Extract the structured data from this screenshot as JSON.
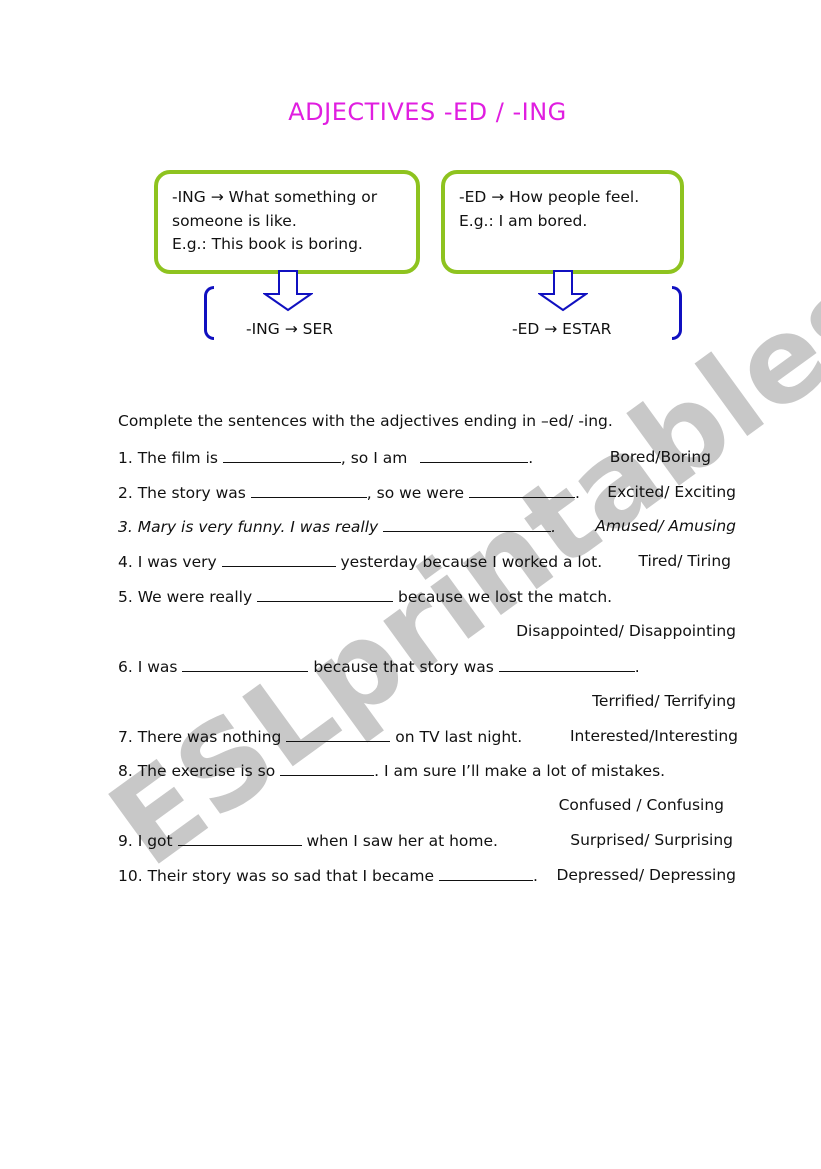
{
  "watermark": "ESLprintables.com",
  "title": "ADJECTIVES -ED / -ING",
  "colors": {
    "title": "#e01ee0",
    "box_border": "#8ec31f",
    "arrow": "#1010c0",
    "watermark": "#c8c8c8"
  },
  "rule_boxes": [
    {
      "lines": [
        "-ING → What something or",
        "someone is like.",
        "E.g.: This book is boring."
      ]
    },
    {
      "lines": [
        "-ED → How people feel.",
        "E.g.: I am bored."
      ]
    }
  ],
  "translations": {
    "ing": "-ING → SER",
    "ed": "-ED → ESTAR"
  },
  "instructions": "Complete the sentences with the adjectives ending in –ed/ -ing.",
  "sentences": [
    {
      "parts": [
        "1. The film is ",
        ", so I am ",
        "."
      ],
      "options": "Bored/Boring"
    },
    {
      "parts": [
        "2. The story was ",
        ", so we were ",
        "."
      ],
      "options": "Excited/ Exciting"
    },
    {
      "parts": [
        "3. Mary is very funny. I was really ",
        "."
      ],
      "options": "Amused/ Amusing"
    },
    {
      "parts": [
        "4. I was very ",
        " yesterday because I worked a lot."
      ],
      "options": "Tired/ Tiring"
    },
    {
      "parts": [
        "5. We were really ",
        " because we lost the match."
      ],
      "options": "Disappointed/ Disappointing"
    },
    {
      "parts": [
        "6. I was ",
        " because that story was ",
        "."
      ],
      "options": "Terrified/ Terrifying"
    },
    {
      "parts": [
        "7. There was nothing ",
        " on TV last night."
      ],
      "options": "Interested/Interesting"
    },
    {
      "parts": [
        "8. The exercise is so ",
        ". I am sure I’ll make a lot of mistakes."
      ],
      "options": "Confused / Confusing"
    },
    {
      "parts": [
        "9. I got ",
        " when I saw her at home."
      ],
      "options": "Surprised/ Surprising"
    },
    {
      "parts": [
        "10. Their story was so sad that I became ",
        "."
      ],
      "options": "Depressed/ Depressing"
    }
  ]
}
